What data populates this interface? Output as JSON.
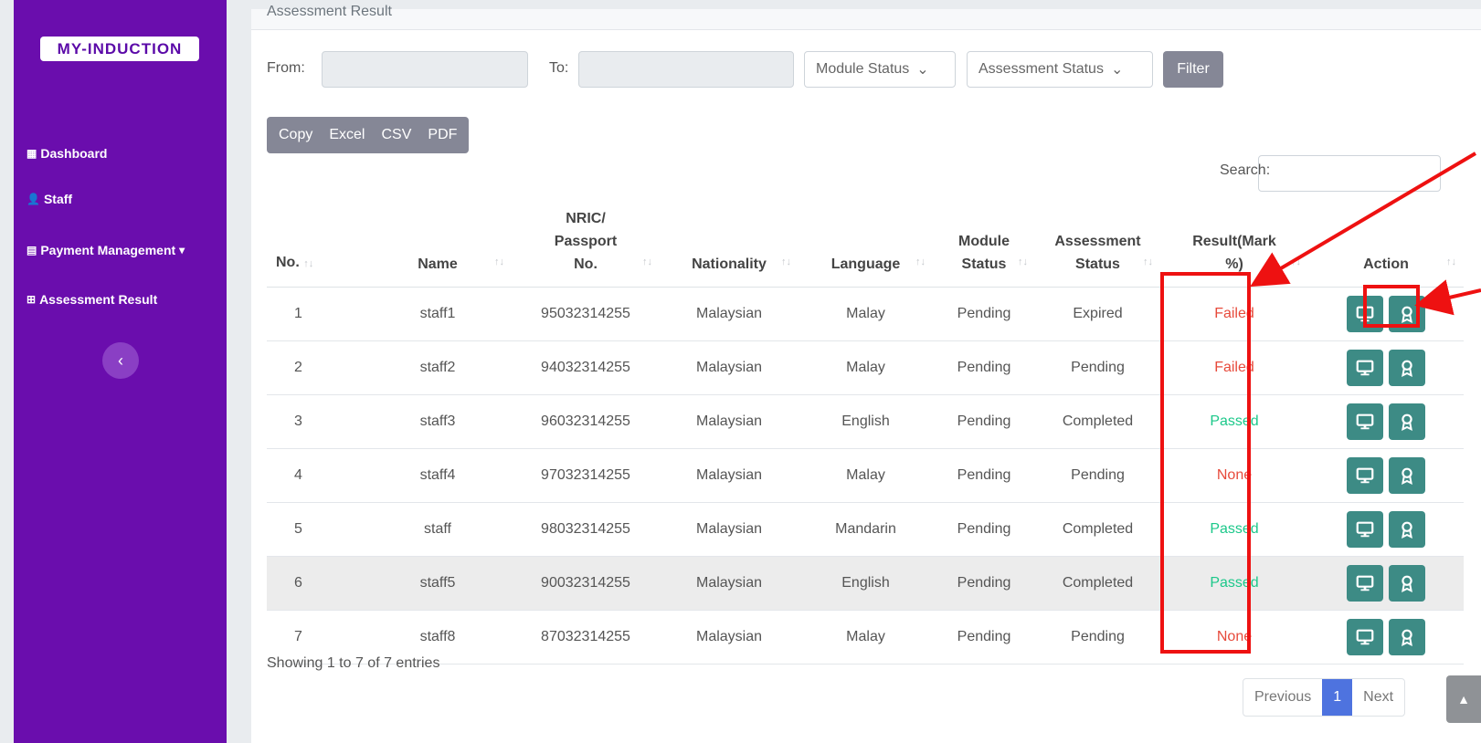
{
  "sidebar": {
    "logo": "MY-INDUCTION",
    "items": [
      {
        "label": "Dashboard",
        "icon": "grid-icon"
      },
      {
        "label": "Staff",
        "icon": "user-tie-icon"
      },
      {
        "label": "Payment Management",
        "icon": "list-alt-icon"
      },
      {
        "label": "Assessment Result",
        "icon": "table-icon"
      }
    ],
    "collapse_glyph": "‹"
  },
  "card": {
    "title": "Assessment Result"
  },
  "filters": {
    "from_label": "From:",
    "to_label": "To:",
    "module_status": "Module Status",
    "assessment_status": "Assessment Status",
    "filter_button": "Filter"
  },
  "export": {
    "copy": "Copy",
    "excel": "Excel",
    "csv": "CSV",
    "pdf": "PDF"
  },
  "search": {
    "label": "Search:"
  },
  "table": {
    "headers": {
      "no": "No.",
      "name": "Name",
      "nric_l1": "NRIC/",
      "nric_l2": "Passport",
      "nric_l3": "No.",
      "nationality": "Nationality",
      "language": "Language",
      "module_l1": "Module",
      "module_l2": "Status",
      "assessment_l1": "Assessment",
      "assessment_l2": "Status",
      "result_l1": "Result(Mark",
      "result_l2": "%)",
      "action": "Action"
    },
    "rows": [
      {
        "no": "1",
        "name": "staff1",
        "nric": "95032314255",
        "nationality": "Malaysian",
        "language": "Malay",
        "module_status": "Pending",
        "assessment_status": "Expired",
        "result": "Failed"
      },
      {
        "no": "2",
        "name": "staff2",
        "nric": "94032314255",
        "nationality": "Malaysian",
        "language": "Malay",
        "module_status": "Pending",
        "assessment_status": "Pending",
        "result": "Failed"
      },
      {
        "no": "3",
        "name": "staff3",
        "nric": "96032314255",
        "nationality": "Malaysian",
        "language": "English",
        "module_status": "Pending",
        "assessment_status": "Completed",
        "result": "Passed"
      },
      {
        "no": "4",
        "name": "staff4",
        "nric": "97032314255",
        "nationality": "Malaysian",
        "language": "Malay",
        "module_status": "Pending",
        "assessment_status": "Pending",
        "result": "None"
      },
      {
        "no": "5",
        "name": "staff",
        "nric": "98032314255",
        "nationality": "Malaysian",
        "language": "Mandarin",
        "module_status": "Pending",
        "assessment_status": "Completed",
        "result": "Passed"
      },
      {
        "no": "6",
        "name": "staff5",
        "nric": "90032314255",
        "nationality": "Malaysian",
        "language": "English",
        "module_status": "Pending",
        "assessment_status": "Completed",
        "result": "Passed"
      },
      {
        "no": "7",
        "name": "staff8",
        "nric": "87032314255",
        "nationality": "Malaysian",
        "language": "Malay",
        "module_status": "Pending",
        "assessment_status": "Pending",
        "result": "None"
      }
    ]
  },
  "footer": {
    "info": "Showing 1 to 7 of 7 entries"
  },
  "pagination": {
    "previous": "Previous",
    "page": "1",
    "next": "Next"
  },
  "colors": {
    "sidebar": "#6a0dad",
    "action_button": "#3d8b85",
    "failed": "#e74a3b",
    "passed": "#1cc88a",
    "annotation": "#ee1111"
  }
}
